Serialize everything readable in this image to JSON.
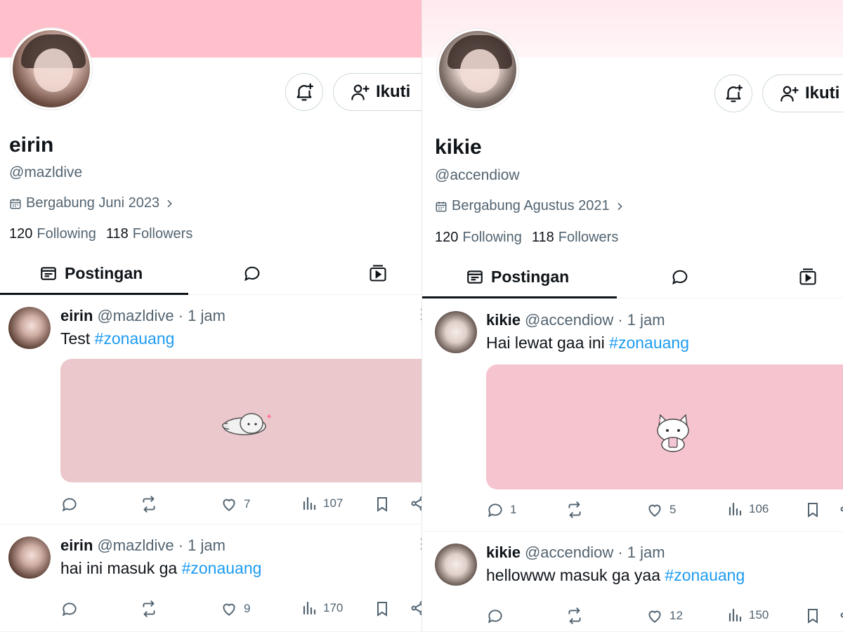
{
  "panels": [
    {
      "display_name": "eirin",
      "handle": "@mazldive",
      "joined": "Bergabung Juni 2023",
      "following_count": "120",
      "following_label": "Following",
      "followers_count": "118",
      "followers_label": "Followers",
      "follow_label": "Ikuti",
      "tab_posts_label": "Postingan",
      "posts": [
        {
          "name": "eirin",
          "handle": "@mazldive",
          "time": "· 1 jam",
          "text": "Test",
          "hashtag": "#zonauang",
          "has_media": true,
          "replies": "",
          "likes": "7",
          "views": "107"
        },
        {
          "name": "eirin",
          "handle": "@mazldive",
          "time": "· 1 jam",
          "text": "hai ini masuk ga",
          "hashtag": "#zonauang",
          "has_media": false,
          "replies": "",
          "likes": "9",
          "views": "170"
        }
      ]
    },
    {
      "display_name": "kikie",
      "handle": "@accendiow",
      "joined": "Bergabung Agustus 2021",
      "following_count": "120",
      "following_label": "Following",
      "followers_count": "118",
      "followers_label": "Followers",
      "follow_label": "Ikuti",
      "tab_posts_label": "Postingan",
      "posts": [
        {
          "name": "kikie",
          "handle": "@accendiow",
          "time": "· 1 jam",
          "text": "Hai lewat gaa ini",
          "hashtag": "#zonauang",
          "has_media": true,
          "replies": "1",
          "likes": "5",
          "views": "106"
        },
        {
          "name": "kikie",
          "handle": "@accendiow",
          "time": "· 1 jam",
          "text": "hellowww masuk ga yaa",
          "hashtag": "#zonauang",
          "has_media": false,
          "replies": "",
          "likes": "12",
          "views": "150"
        }
      ]
    }
  ],
  "colors": {
    "banner_left": "#ffc0cb",
    "banner_right": "#ffe9ee",
    "hashtag": "#1d9bf0",
    "muted": "#536471",
    "text": "#0f1419"
  },
  "icons": [
    "bell-plus-icon",
    "person-plus-icon",
    "calendar-icon",
    "chevron-right-icon",
    "posts-tab-icon",
    "replies-tab-icon",
    "media-tab-icon",
    "reply-icon",
    "retweet-icon",
    "like-icon",
    "views-icon",
    "bookmark-icon",
    "share-icon",
    "more-icon"
  ]
}
